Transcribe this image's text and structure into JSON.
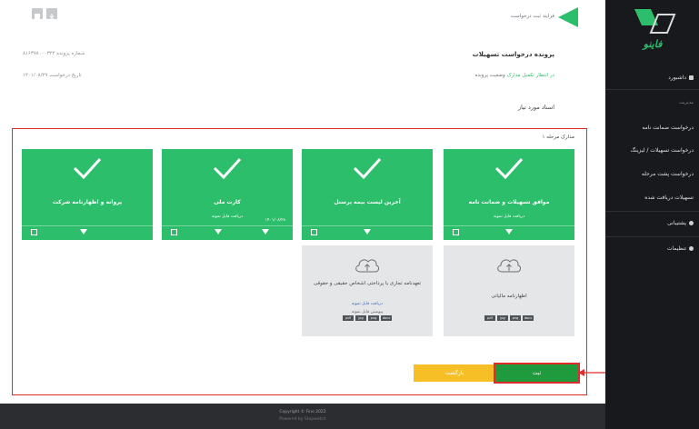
{
  "header": {
    "title": "فرایند ثبت درخواست"
  },
  "request": {
    "heading": "پرونده درخواست تسهیلات",
    "status_label": "وضعیت پرونده",
    "status_value": "در انتظار تکمیل مدارک",
    "case_number_label": "شماره پرونده",
    "case_number_value": "۸۱۶۳۷۸۰۰۰۳۲۲",
    "request_date_label": "تاریخ درخواست",
    "request_date_value": "۱۴۰۱/۰۸/۲۹",
    "section_title": "اسناد مورد نیاز",
    "stage_title": "مدارک مرحله ۱"
  },
  "cards": [
    {
      "title": "موافق تسهیلات و ضمانت نامه",
      "sub": "دریافت فایل نمونه",
      "extra": ""
    },
    {
      "title": "آخرین لیست بیمه پرسنل",
      "sub": "",
      "extra": ""
    },
    {
      "title": "کارت ملی",
      "sub": "دریافت فایل نمونه",
      "extra": "۱۴۰۱/۰۸/۲۸"
    },
    {
      "title": "پروانه و اظهارنامه شرکت",
      "sub": "",
      "extra": ""
    }
  ],
  "upload_cards": [
    {
      "title": "اظهارنامه مالیاتی",
      "sub": ""
    },
    {
      "title": "تعهدنامه تجاری یا پرداختی اشخاص حقیقی و حقوقی",
      "sub": "دریافت فایل نمونه",
      "sub2": "پیوستن فایل نمونه"
    }
  ],
  "formats": [
    "pdf",
    "jpg",
    "png",
    "docx"
  ],
  "buttons": {
    "submit": "ثبت",
    "back": "بازگشت"
  },
  "sidebar": {
    "brand": "فاینو",
    "items": [
      {
        "label": "داشبورد",
        "icon": "home-icon"
      },
      {
        "label": "مدیریت",
        "icon": ""
      },
      {
        "label": "درخواست ضمانت نامه",
        "icon": ""
      },
      {
        "label": "درخواست تسهیلات / لیزینگ",
        "icon": ""
      },
      {
        "label": "درخواست پشت مرحله",
        "icon": ""
      },
      {
        "label": "تسهیلات دریافت شده",
        "icon": ""
      },
      {
        "label": "پشتیبانی",
        "icon": "support-icon"
      },
      {
        "label": "تنظیمات",
        "icon": "settings-icon"
      }
    ]
  },
  "footer": {
    "line1": "Copyright © Fino 2022",
    "line2": "Powered by Stopwatch"
  },
  "colors": {
    "accent_green": "#2dbe6c",
    "submit_green": "#1f9a3d",
    "back_yellow": "#f6bf26",
    "highlight_red": "#e02b2b",
    "sidebar_bg": "#17191c"
  }
}
